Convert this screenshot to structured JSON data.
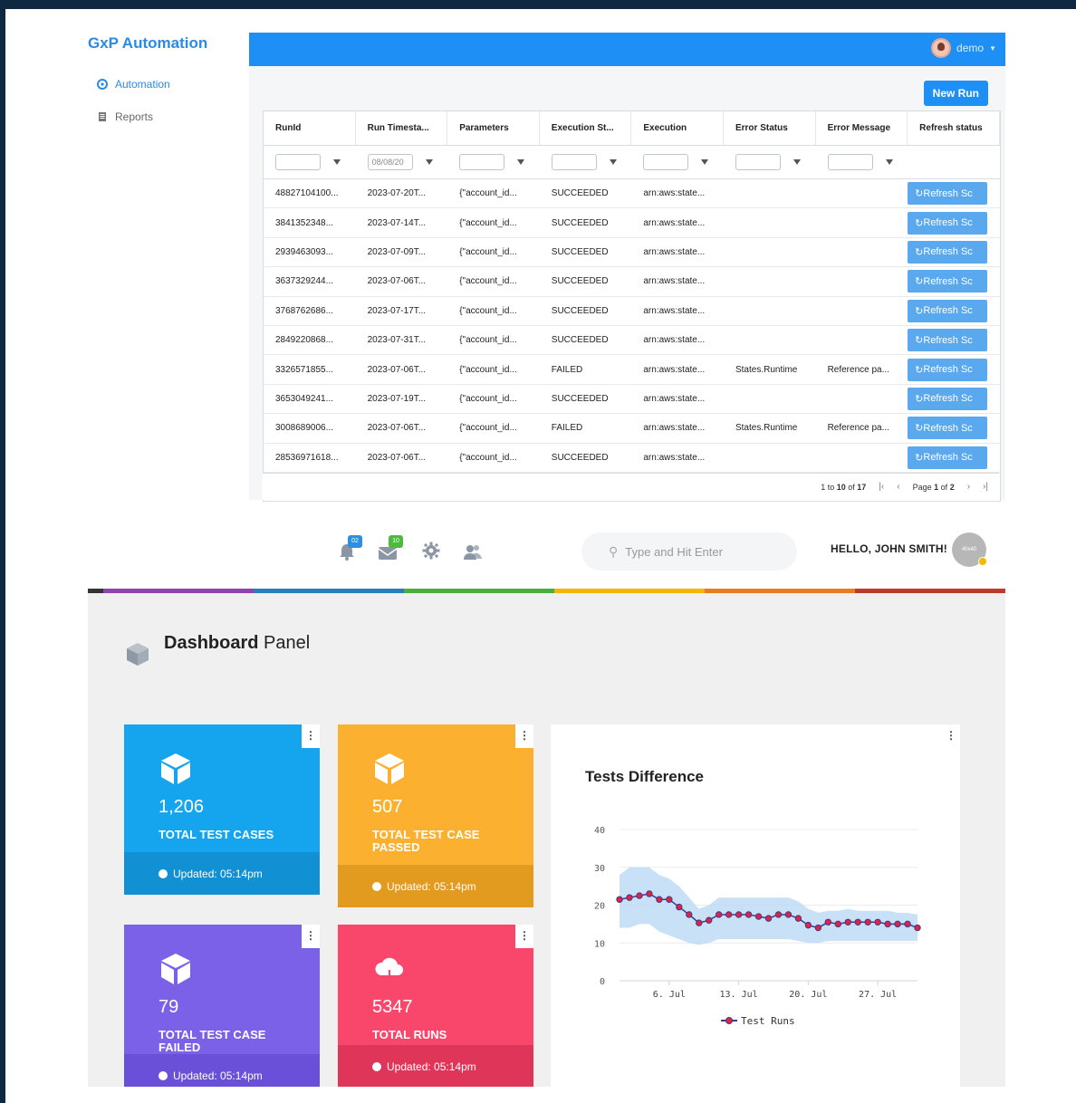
{
  "top_app": {
    "brand": "GxP Automation",
    "user": "demo",
    "nav": [
      {
        "label": "Automation",
        "active": true,
        "icon": "gear-icon"
      },
      {
        "label": "Reports",
        "active": false,
        "icon": "document-icon"
      }
    ],
    "new_run_label": "New Run",
    "columns": [
      "RunId",
      "Run Timesta...",
      "Parameters",
      "Execution St...",
      "Execution",
      "Error Status",
      "Error Message",
      "Refresh status"
    ],
    "date_filter": "08/08/20",
    "rows": [
      {
        "run_id": "48827104100...",
        "timestamp": "2023-07-20T...",
        "params": "{\"account_id...",
        "status": "SUCCEEDED",
        "execution": "arn:aws:state...",
        "error_status": "",
        "error_message": "",
        "refresh": "Refresh Sc"
      },
      {
        "run_id": "3841352348...",
        "timestamp": "2023-07-14T...",
        "params": "{\"account_id...",
        "status": "SUCCEEDED",
        "execution": "arn:aws:state...",
        "error_status": "",
        "error_message": "",
        "refresh": "Refresh Sc"
      },
      {
        "run_id": "2939463093...",
        "timestamp": "2023-07-09T...",
        "params": "{\"account_id...",
        "status": "SUCCEEDED",
        "execution": "arn:aws:state...",
        "error_status": "",
        "error_message": "",
        "refresh": "Refresh Sc"
      },
      {
        "run_id": "3637329244...",
        "timestamp": "2023-07-06T...",
        "params": "{\"account_id...",
        "status": "SUCCEEDED",
        "execution": "arn:aws:state...",
        "error_status": "",
        "error_message": "",
        "refresh": "Refresh Sc"
      },
      {
        "run_id": "3768762686...",
        "timestamp": "2023-07-17T...",
        "params": "{\"account_id...",
        "status": "SUCCEEDED",
        "execution": "arn:aws:state...",
        "error_status": "",
        "error_message": "",
        "refresh": "Refresh Sc"
      },
      {
        "run_id": "2849220868...",
        "timestamp": "2023-07-31T...",
        "params": "{\"account_id...",
        "status": "SUCCEEDED",
        "execution": "arn:aws:state...",
        "error_status": "",
        "error_message": "",
        "refresh": "Refresh Sc"
      },
      {
        "run_id": "3326571855...",
        "timestamp": "2023-07-06T...",
        "params": "{\"account_id...",
        "status": "FAILED",
        "execution": "arn:aws:state...",
        "error_status": "States.Runtime",
        "error_message": "Reference pa...",
        "refresh": "Refresh Sc"
      },
      {
        "run_id": "3653049241...",
        "timestamp": "2023-07-19T...",
        "params": "{\"account_id...",
        "status": "SUCCEEDED",
        "execution": "arn:aws:state...",
        "error_status": "",
        "error_message": "",
        "refresh": "Refresh Sc"
      },
      {
        "run_id": "3008689006...",
        "timestamp": "2023-07-06T...",
        "params": "{\"account_id...",
        "status": "FAILED",
        "execution": "arn:aws:state...",
        "error_status": "States.Runtime",
        "error_message": "Reference pa...",
        "refresh": "Refresh Sc"
      },
      {
        "run_id": "28536971618...",
        "timestamp": "2023-07-06T...",
        "params": "{\"account_id...",
        "status": "SUCCEEDED",
        "execution": "arn:aws:state...",
        "error_status": "",
        "error_message": "",
        "refresh": "Refresh Sc"
      }
    ],
    "pager": {
      "range_prefix": "1 to",
      "range_end": "10",
      "of": "of",
      "total": "17",
      "page_label": "Page",
      "page": "1",
      "page_of": "of",
      "page_total": "2"
    }
  },
  "bottom_app": {
    "notifications_badge": "02",
    "messages_badge": "10",
    "search_placeholder": "Type and Hit Enter",
    "greeting": "HELLO, JOHN SMITH!",
    "avatar_text": "40x40",
    "rainbow_colors": [
      "#333333",
      "#8e44ad",
      "#2980b9",
      "#4cae3c",
      "#f2b705",
      "#e67e22",
      "#c0392b"
    ],
    "page_title_bold": "Dashboard",
    "page_title_rest": " Panel",
    "cards": [
      {
        "value": "1,206",
        "label": "TOTAL TEST CASES",
        "updated": "Updated: 05:14pm",
        "color": "#14a5ee",
        "foot_color": "#1190d3",
        "icon": "cube-icon"
      },
      {
        "value": "507",
        "label": "TOTAL TEST CASE PASSED",
        "updated": "Updated: 05:14pm",
        "color": "#fbb12f",
        "foot_color": "#e29a1f",
        "icon": "cube-icon"
      },
      {
        "value": "79",
        "label": "TOTAL TEST CASE FAILED",
        "updated": "Updated: 05:14pm",
        "color": "#7b61e8",
        "foot_color": "#6a50d8",
        "icon": "cube-icon"
      },
      {
        "value": "5347",
        "label": "TOTAL RUNS",
        "updated": "Updated: 05:14pm",
        "color": "#f8476a",
        "foot_color": "#df3559",
        "icon": "cloud-download-icon"
      }
    ],
    "chart_title": "Tests Difference"
  },
  "chart_data": {
    "type": "line",
    "title": "Tests Difference",
    "x_ticks": [
      "6. Jul",
      "13. Jul",
      "20. Jul",
      "27. Jul"
    ],
    "y_ticks": [
      0,
      10,
      20,
      30,
      40
    ],
    "ylim": [
      0,
      40
    ],
    "series": [
      {
        "name": "Test Runs",
        "x": [
          "Jul 1",
          "Jul 2",
          "Jul 3",
          "Jul 4",
          "Jul 5",
          "Jul 6",
          "Jul 7",
          "Jul 8",
          "Jul 9",
          "Jul 10",
          "Jul 11",
          "Jul 12",
          "Jul 13",
          "Jul 14",
          "Jul 15",
          "Jul 16",
          "Jul 17",
          "Jul 18",
          "Jul 19",
          "Jul 20",
          "Jul 21",
          "Jul 22",
          "Jul 23",
          "Jul 24",
          "Jul 25",
          "Jul 26",
          "Jul 27",
          "Jul 28",
          "Jul 29",
          "Jul 30",
          "Jul 31"
        ],
        "values": [
          21.5,
          22,
          22.5,
          23,
          21.5,
          21.5,
          19.5,
          17.5,
          15.3,
          16,
          17.5,
          17.5,
          17.5,
          17.5,
          17,
          16.5,
          17.5,
          17.5,
          16.5,
          14.7,
          14,
          15.5,
          15,
          15.5,
          15.5,
          15.5,
          15.5,
          15,
          15,
          15,
          14
        ],
        "range_low": [
          14,
          14,
          15,
          15,
          13,
          12,
          11,
          10,
          9.5,
          10,
          11,
          11,
          11,
          11,
          11,
          11,
          11,
          11,
          10.5,
          10,
          10,
          10.5,
          10.5,
          10.5,
          10.5,
          10.5,
          10.5,
          10.5,
          10.5,
          10.5,
          10.5
        ],
        "range_high": [
          28,
          30,
          30,
          30,
          28,
          27,
          25,
          22,
          19,
          20,
          22,
          22,
          22,
          22,
          22,
          22,
          22,
          22,
          21,
          19,
          18,
          18.5,
          18.5,
          19,
          18.5,
          18.5,
          18.5,
          18.5,
          18,
          18,
          17.5
        ]
      }
    ],
    "legend": "bottom-center"
  }
}
